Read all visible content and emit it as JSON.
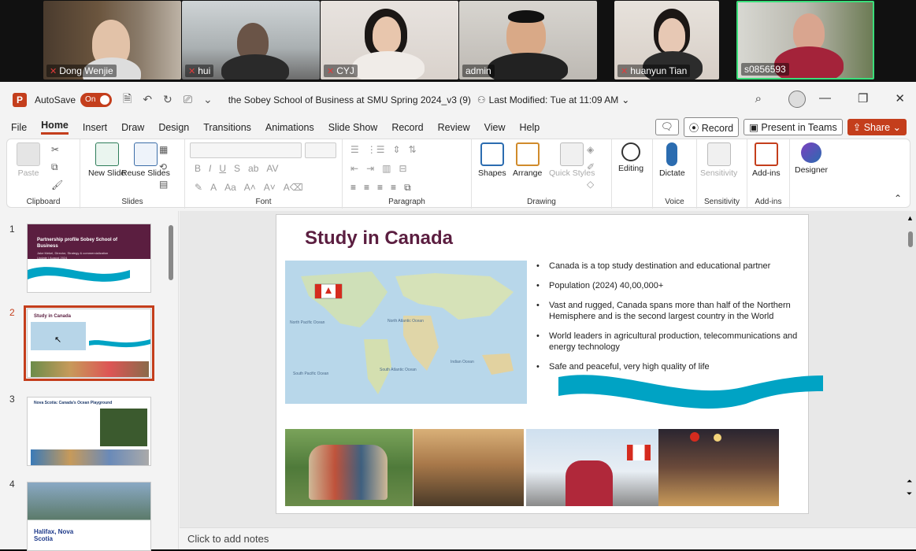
{
  "participants": [
    {
      "name": "Dong Wenjie",
      "muted": true
    },
    {
      "name": "hui",
      "muted": true
    },
    {
      "name": "CYJ",
      "muted": true
    },
    {
      "name": "admin",
      "muted": false
    },
    {
      "name": "huanyun Tian",
      "muted": true
    },
    {
      "name": "s0856593",
      "muted": false
    }
  ],
  "titlebar": {
    "logo": "P",
    "autosave_label": "AutoSave",
    "autosave_state": "On",
    "doc_title": "the Sobey School of Business at SMU Spring 2024_v3 (9)",
    "last_modified": "Last Modified: Tue at 11:09 AM",
    "minimize": "—",
    "restore": "❐",
    "close": "✕"
  },
  "menu": {
    "tabs": [
      "File",
      "Home",
      "Insert",
      "Draw",
      "Design",
      "Transitions",
      "Animations",
      "Slide Show",
      "Record",
      "Review",
      "View",
      "Help"
    ],
    "active_tab": "Home",
    "record_btn": "Record",
    "present_btn": "Present in Teams",
    "share_btn": "Share"
  },
  "ribbon": {
    "clipboard": {
      "label": "Clipboard",
      "paste": "Paste"
    },
    "slides": {
      "label": "Slides",
      "new_slide": "New Slide",
      "reuse_slides": "Reuse Slides"
    },
    "font": {
      "label": "Font"
    },
    "paragraph": {
      "label": "Paragraph"
    },
    "drawing": {
      "label": "Drawing",
      "shapes": "Shapes",
      "arrange": "Arrange",
      "quick_styles": "Quick Styles"
    },
    "editing": {
      "label": "Editing"
    },
    "voice": {
      "label": "Voice",
      "dictate": "Dictate"
    },
    "sensitivity": {
      "label": "Sensitivity",
      "btn": "Sensitivity"
    },
    "addins": {
      "label": "Add-ins",
      "btn": "Add-ins"
    },
    "designer": {
      "btn": "Designer"
    }
  },
  "thumbnails": [
    {
      "num": "1",
      "title": "Partnership profile Sobey School of Business",
      "subtitle": "Jake Mekel, Director, Strategy & commercialization Update | August 2024"
    },
    {
      "num": "2",
      "title": "Study in Canada",
      "selected": true
    },
    {
      "num": "3",
      "title": "Nova Scotia: Canada's Ocean Playground"
    },
    {
      "num": "4",
      "title": "Halifax, Nova Scotia"
    }
  ],
  "slide": {
    "title": "Study in Canada",
    "bullets": [
      "Canada is a top study destination and educational partner",
      "Population (2024) 40,00,000+",
      "Vast and rugged, Canada spans more than half of the Northern Hemisphere and is the second largest country in the World",
      "World leaders in agricultural production, telecommunications and energy technology",
      "Safe and peaceful, very high quality of life"
    ],
    "map_labels": [
      "North Atlantic Ocean",
      "South Atlantic Ocean",
      "North Pacific Ocean",
      "South Pacific Ocean",
      "Indian Ocean"
    ]
  },
  "notes": {
    "placeholder": "Click to add notes"
  },
  "colors": {
    "accent": "#c43e1c",
    "title": "#5b1e40",
    "wave": "#00a3c4"
  }
}
